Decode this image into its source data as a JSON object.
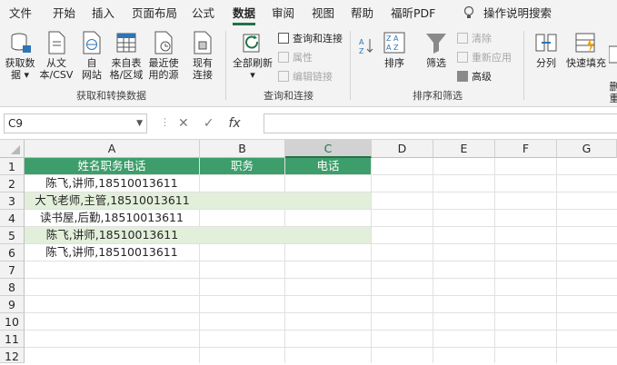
{
  "tabs": [
    "文件",
    "开始",
    "插入",
    "页面布局",
    "公式",
    "数据",
    "审阅",
    "视图",
    "帮助",
    "福昕PDF",
    "操作说明搜索"
  ],
  "active_tab": "数据",
  "ribbon": {
    "get_transform": {
      "buttons": [
        {
          "label1": "获取数",
          "label2": "据 ▾"
        },
        {
          "label1": "从文",
          "label2": "本/CSV"
        },
        {
          "label1": "自",
          "label2": "网站"
        },
        {
          "label1": "来自表",
          "label2": "格/区域"
        },
        {
          "label1": "最近使",
          "label2": "用的源"
        },
        {
          "label1": "现有",
          "label2": "连接"
        }
      ],
      "group_label": "获取和转换数据"
    },
    "queries": {
      "refresh_label1": "全部刷新",
      "refresh_label2": "▾",
      "items": [
        "查询和连接",
        "属性",
        "编辑链接"
      ],
      "group_label": "查询和连接"
    },
    "sort_filter": {
      "sort_label": "排序",
      "filter_label": "筛选",
      "items": [
        "清除",
        "重新应用",
        "高级"
      ],
      "group_label": "排序和筛选"
    },
    "tools": {
      "split_label": "分列",
      "fill_label": "快速填充",
      "last_label": "删\n重"
    }
  },
  "formula_bar": {
    "name_box": "C9",
    "formula": ""
  },
  "columns": [
    "A",
    "B",
    "C",
    "D",
    "E",
    "F",
    "G"
  ],
  "rows": [
    "1",
    "2",
    "3",
    "4",
    "5",
    "6",
    "7",
    "8",
    "9",
    "10",
    "11",
    "12"
  ],
  "cells": {
    "header": [
      "姓名职务电话",
      "职务",
      "电话"
    ],
    "data": [
      "陈飞,讲师,18510013611",
      "大飞老师,主管,18510013611",
      "读书屋,后勤,18510013611",
      "陈飞,讲师,18510013611",
      "陈飞,讲师,18510013611"
    ]
  },
  "colors": {
    "accent": "#217346",
    "header_fill": "#3d9e6b",
    "band_fill": "#e2efda"
  }
}
